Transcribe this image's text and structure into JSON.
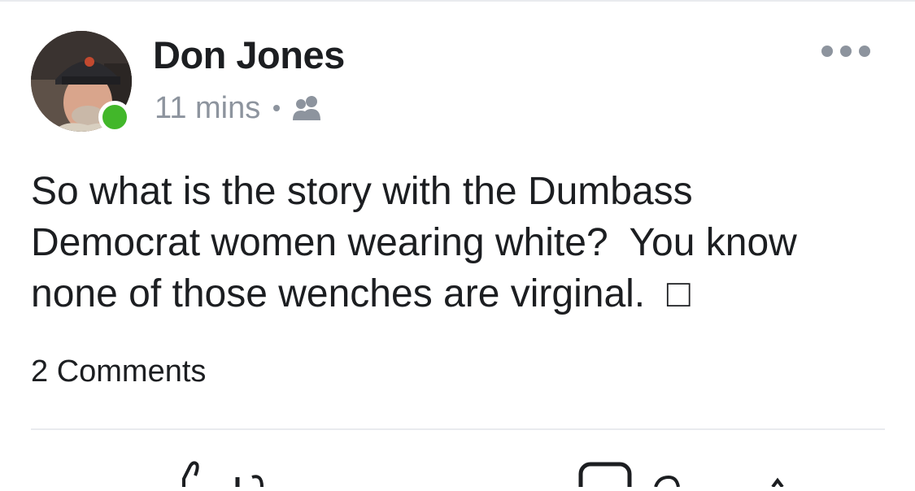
{
  "post": {
    "author": "Don Jones",
    "time": "11 mins",
    "audience_icon": "friends-icon",
    "text": "So what is the story with the Dumbass\nDemocrat women wearing white?  You know\nnone of those wenches are virginal.  □",
    "comments_count": "2 Comments",
    "online_status_color": "#42b72a"
  },
  "actions": {
    "like_icon": "thumbs-up-icon",
    "comment_icon": "comment-icon"
  }
}
